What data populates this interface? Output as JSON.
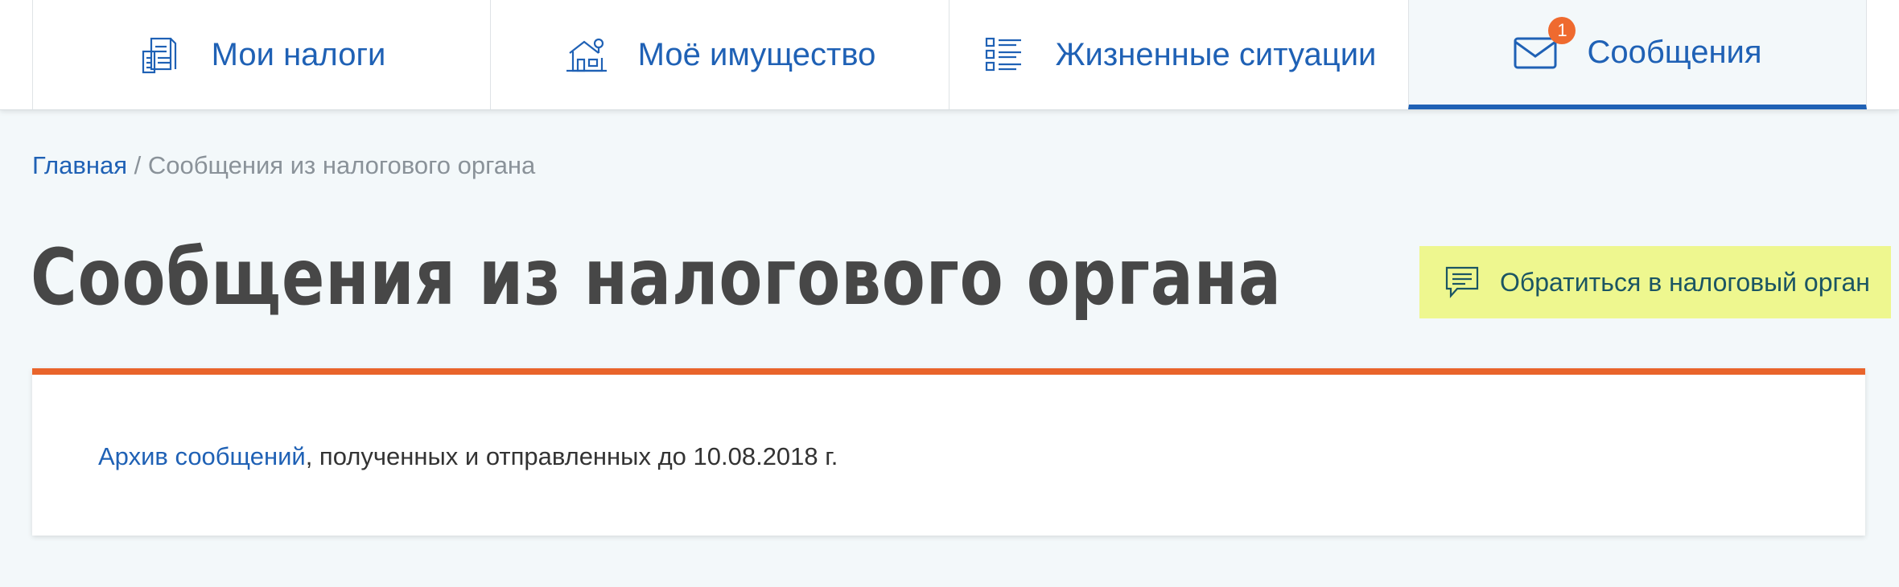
{
  "nav": {
    "tabs": [
      {
        "label": "Мои налоги",
        "icon": "tax-document-icon"
      },
      {
        "label": "Моё имущество",
        "icon": "house-icon"
      },
      {
        "label": "Жизненные ситуации",
        "icon": "checklist-icon"
      },
      {
        "label": "Сообщения",
        "icon": "envelope-icon",
        "badge": "1",
        "active": true
      }
    ]
  },
  "breadcrumb": {
    "home": "Главная",
    "separator": " / ",
    "current": "Сообщения из налогового органа"
  },
  "page": {
    "title": "Сообщения из налогового органа"
  },
  "contact_button": {
    "label": "Обратиться в налоговый орган",
    "icon": "chat-bubble-icon"
  },
  "archive": {
    "link_text": "Архив сообщений",
    "rest_text": ", полученных и отправленных до 10.08.2018 г."
  },
  "colors": {
    "accent_blue": "#1f61b5",
    "badge_orange": "#ef6a2f",
    "card_top_border": "#e9642b",
    "contact_bg": "#eef78f",
    "page_bg": "#f3f8fa"
  }
}
